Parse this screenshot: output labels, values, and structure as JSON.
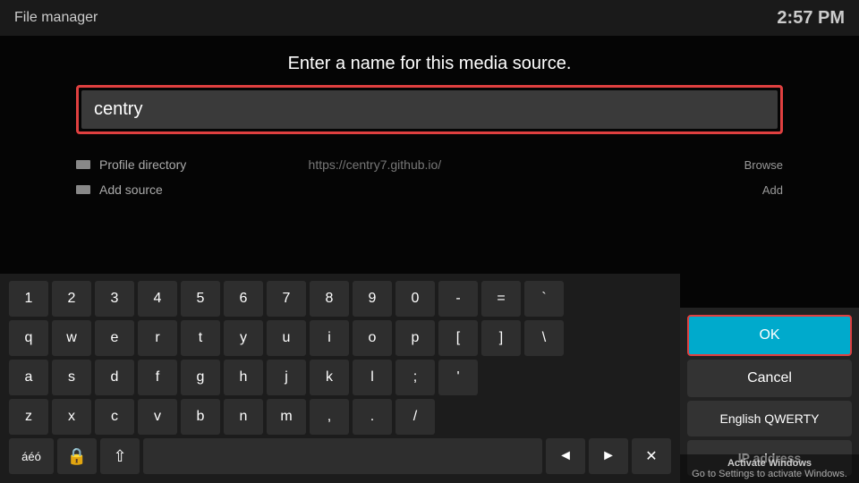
{
  "topBar": {
    "title": "File manager",
    "time": "2:57 PM"
  },
  "dialog": {
    "prompt": "Enter a name for this media source.",
    "inputValue": "centry"
  },
  "fileManager": {
    "rows": [
      {
        "label": "Profile directory",
        "url": "https://centry7.github.io/",
        "action": "Browse"
      },
      {
        "label": "Add source",
        "url": "",
        "action": "Add"
      }
    ]
  },
  "keyboard": {
    "rows": [
      [
        "1",
        "2",
        "3",
        "4",
        "5",
        "6",
        "7",
        "8",
        "9",
        "0",
        "-",
        "=",
        "`"
      ],
      [
        "q",
        "w",
        "e",
        "r",
        "t",
        "y",
        "u",
        "i",
        "o",
        "p",
        "[",
        "]",
        "\\"
      ],
      [
        "a",
        "s",
        "d",
        "f",
        "g",
        "h",
        "j",
        "k",
        "l",
        ";",
        "'"
      ],
      [
        "z",
        "x",
        "c",
        "v",
        "b",
        "n",
        "m",
        ",",
        ".",
        "/"
      ]
    ],
    "bottomRow": {
      "specialLeft": "áéó",
      "shift": "⇧",
      "spaceLabel": "",
      "leftArrow": "◄",
      "rightArrow": "►",
      "backspace": "✕"
    }
  },
  "rightPanel": {
    "okLabel": "OK",
    "cancelLabel": "Cancel",
    "languageLabel": "English QWERTY",
    "ipLabel": "IP address"
  },
  "activateWindows": {
    "title": "Activate Windows",
    "subtitle": "Go to Settings to activate Windows."
  }
}
